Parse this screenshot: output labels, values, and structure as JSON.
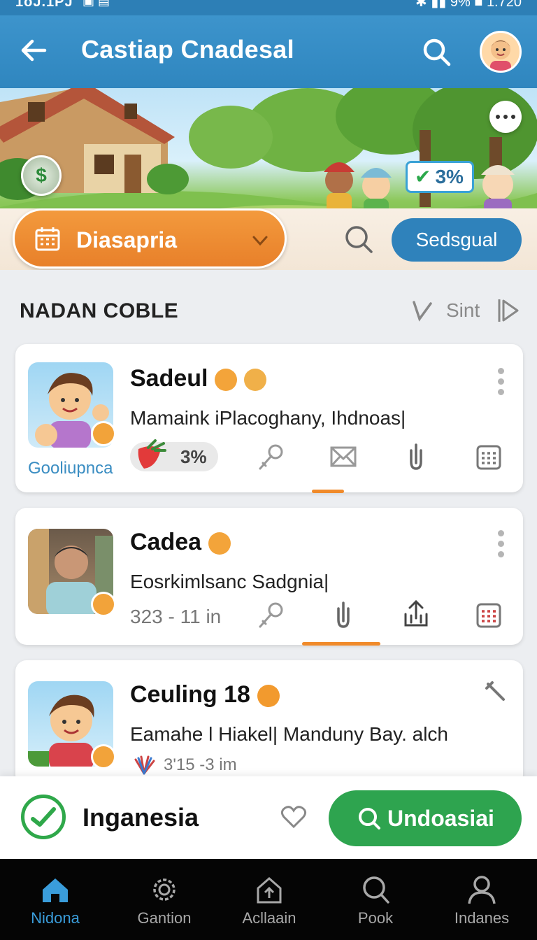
{
  "status_bar": {
    "time_left": "1oJ.1PJ",
    "battery": "9%",
    "clock": "1.720"
  },
  "app_bar": {
    "title": "Castiap Cnadesal"
  },
  "banner": {
    "badge_value": "3%"
  },
  "filter": {
    "dropdown_label": "Diasapria",
    "button_label": "Sedsgual"
  },
  "section": {
    "title": "NADAN COBLE",
    "sort_label": "Sint"
  },
  "cards": [
    {
      "name": "Sadeul",
      "desc": "Mamaink iPlacoghany, Ihdnoas|",
      "caption": "Gooliupnca",
      "pill_value": "3%"
    },
    {
      "name": "Cadea",
      "desc": "Eosrkimlsanc Sadgnia|",
      "stat": "323 - 11 in"
    },
    {
      "name": "Ceuling 18",
      "desc": "Eamahe l Hiakel| Manduny Bay. alch",
      "stat": "3'15 -3 im"
    }
  ],
  "action_bar": {
    "label": "Inganesia",
    "cta_label": "Undoasiai"
  },
  "nav": [
    {
      "label": "Nidona",
      "icon": "home-icon"
    },
    {
      "label": "Gantion",
      "icon": "gear-icon"
    },
    {
      "label": "Acllaain",
      "icon": "home-upload-icon"
    },
    {
      "label": "Pook",
      "icon": "search-icon"
    },
    {
      "label": "Indanes",
      "icon": "profile-icon"
    }
  ],
  "colors": {
    "primary": "#2f86bf",
    "accent_orange": "#e8802a",
    "success": "#2ea44f",
    "nav_active": "#3a9ddb"
  }
}
